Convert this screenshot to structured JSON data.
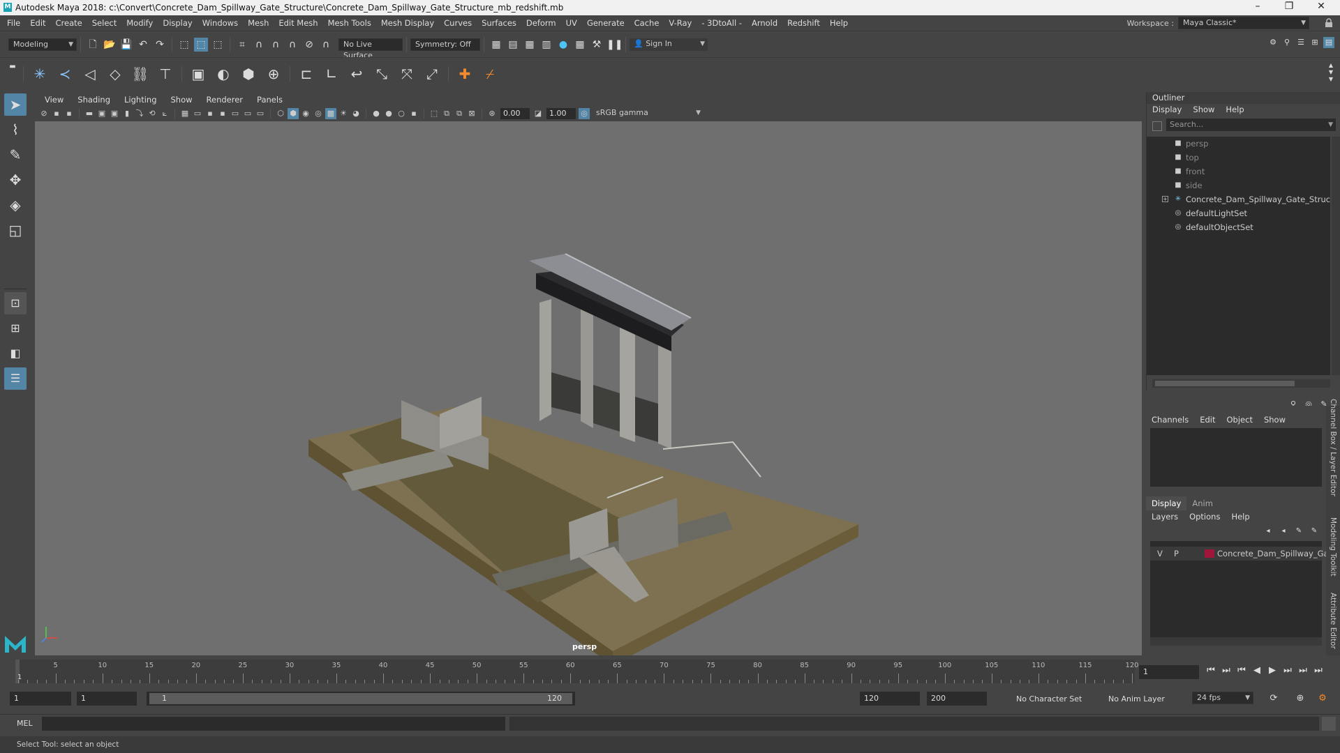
{
  "window": {
    "title": "Autodesk Maya 2018: c:\\Convert\\Concrete_Dam_Spillway_Gate_Structure\\Concrete_Dam_Spillway_Gate_Structure_mb_redshift.mb",
    "logo": "M",
    "minimize": "–",
    "maximize": "❐",
    "close": "✕"
  },
  "menubar": {
    "items": [
      "File",
      "Edit",
      "Create",
      "Select",
      "Modify",
      "Display",
      "Windows",
      "Mesh",
      "Edit Mesh",
      "Mesh Tools",
      "Mesh Display",
      "Curves",
      "Surfaces",
      "Deform",
      "UV",
      "Generate",
      "Cache",
      "V-Ray",
      "- 3DtoAll -",
      "Arnold",
      "Redshift",
      "Help"
    ],
    "workspace_label": "Workspace :",
    "workspace_value": "Maya Classic*"
  },
  "statusline": {
    "menuset": "Modeling",
    "live_surface": "No Live Surface",
    "symmetry": "Symmetry: Off",
    "sign_in": "Sign In"
  },
  "viewport": {
    "menus": [
      "View",
      "Shading",
      "Lighting",
      "Show",
      "Renderer",
      "Panels"
    ],
    "exposure": "0.00",
    "gamma": "1.00",
    "color_space": "sRGB gamma",
    "camera_label": "persp"
  },
  "outliner": {
    "title": "Outliner",
    "menus": [
      "Display",
      "Show",
      "Help"
    ],
    "search_placeholder": "Search...",
    "nodes": [
      {
        "label": "persp",
        "icon": "camera-icon",
        "dim": true
      },
      {
        "label": "top",
        "icon": "camera-icon",
        "dim": true
      },
      {
        "label": "front",
        "icon": "camera-icon",
        "dim": true
      },
      {
        "label": "side",
        "icon": "camera-icon",
        "dim": true
      },
      {
        "label": "Concrete_Dam_Spillway_Gate_Structure_",
        "icon": "group-icon",
        "dim": false,
        "expandable": true
      },
      {
        "label": "defaultLightSet",
        "icon": "set-icon",
        "dim": false
      },
      {
        "label": "defaultObjectSet",
        "icon": "set-icon",
        "dim": false
      }
    ]
  },
  "channelbox": {
    "menus": [
      "Channels",
      "Edit",
      "Object",
      "Show"
    ],
    "side_tab": "Channel Box / Layer Editor"
  },
  "layereditor": {
    "tabs": [
      "Display",
      "Anim"
    ],
    "menus": [
      "Layers",
      "Options",
      "Help"
    ],
    "layer": {
      "v": "V",
      "p": "P",
      "name": "Concrete_Dam_Spillway_Gate_",
      "color": "#a0163a"
    },
    "side_tabs": [
      "Modeling Toolkit",
      "Attribute Editor"
    ]
  },
  "timeslider": {
    "ticks": [
      "5",
      "10",
      "15",
      "20",
      "25",
      "30",
      "35",
      "40",
      "45",
      "50",
      "55",
      "60",
      "65",
      "70",
      "75",
      "80",
      "85",
      "90",
      "95",
      "100",
      "105",
      "110",
      "115",
      "120"
    ],
    "current_frame_marker": "1",
    "current_frame": "1"
  },
  "rangeslider": {
    "start": "1",
    "playback_start": "1",
    "range_start_label": "1",
    "range_end_label": "120",
    "playback_end": "120",
    "end": "200",
    "character_set": "No Character Set",
    "anim_layer": "No Anim Layer",
    "fps": "24 fps"
  },
  "cmdline": {
    "label": "MEL"
  },
  "helpline": {
    "text": "Select Tool: select an object"
  }
}
